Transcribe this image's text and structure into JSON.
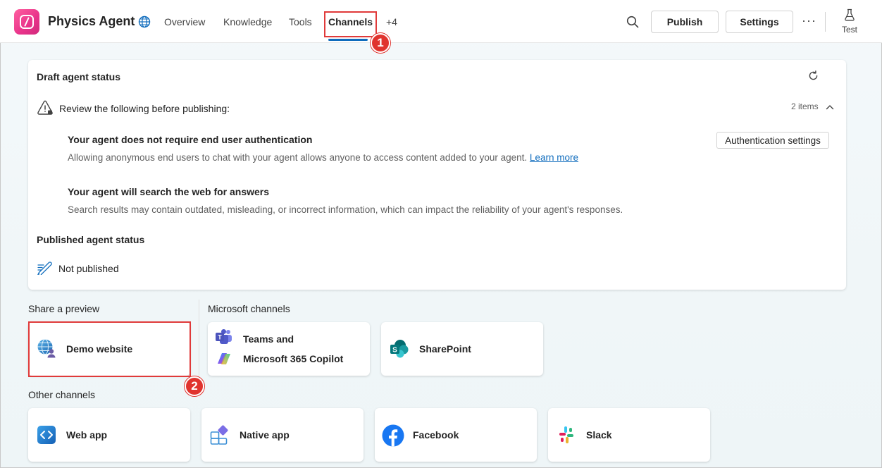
{
  "header": {
    "app_title": "Physics Agent",
    "tabs": [
      {
        "label": "Overview"
      },
      {
        "label": "Knowledge"
      },
      {
        "label": "Tools"
      },
      {
        "label": "Channels",
        "active": true
      },
      {
        "label": "+4"
      }
    ],
    "publish_label": "Publish",
    "settings_label": "Settings",
    "more_label": "···",
    "test_label": "Test"
  },
  "annotations": {
    "step1": "1",
    "step2": "2",
    "highlight_color": "#e03a3a"
  },
  "draft_status": {
    "title": "Draft agent status",
    "review_label": "Review the following before publishing:",
    "count_label": "2 items",
    "items": [
      {
        "title": "Your agent does not require end user authentication",
        "description": "Allowing anonymous end users to chat with your agent allows anyone to access content added to your agent.",
        "link_label": "Learn more",
        "action_label": "Authentication settings"
      },
      {
        "title": "Your agent will search the web for answers",
        "description": "Search results may contain outdated, misleading, or incorrect information, which can impact the reliability of your agent's responses."
      }
    ]
  },
  "published_status": {
    "title": "Published agent status",
    "value": "Not published"
  },
  "share_preview": {
    "title": "Share a preview",
    "items": [
      {
        "label": "Demo website",
        "icon": "globe-person-icon"
      }
    ]
  },
  "microsoft_channels": {
    "title": "Microsoft channels",
    "items": [
      {
        "label_line1": "Teams and",
        "label_line2": "Microsoft 365 Copilot",
        "icon": "teams-copilot-icon"
      },
      {
        "label": "SharePoint",
        "icon": "sharepoint-icon"
      }
    ]
  },
  "other_channels": {
    "title": "Other channels",
    "items": [
      {
        "label": "Web app",
        "icon": "web-app-icon"
      },
      {
        "label": "Native app",
        "icon": "native-app-icon"
      },
      {
        "label": "Facebook",
        "icon": "facebook-icon"
      },
      {
        "label": "Slack",
        "icon": "slack-icon"
      }
    ]
  },
  "colors": {
    "accent": "#0f6cbd",
    "brand_logo": "#e8338a"
  }
}
